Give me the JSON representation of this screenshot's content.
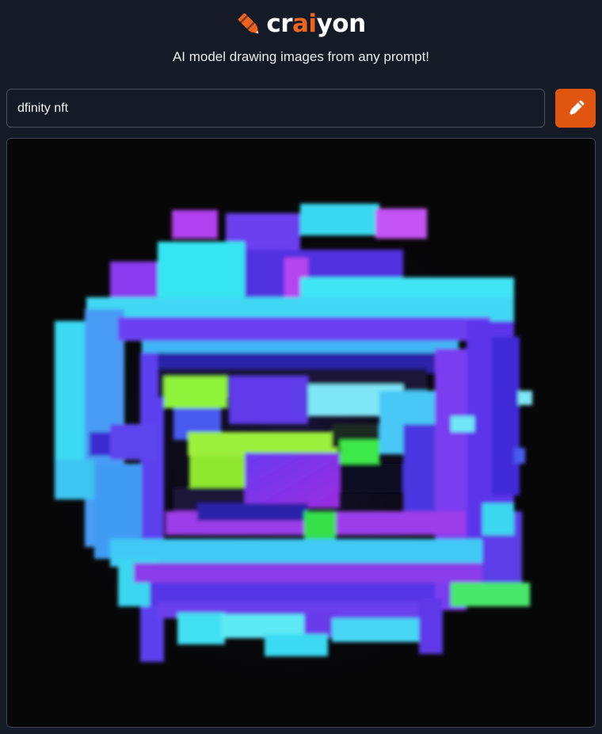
{
  "header": {
    "logo_text_part1": "cr",
    "logo_text_accent": "ai",
    "logo_text_part2": "yon",
    "tagline": "AI model drawing images from any prompt!",
    "logo_icon": "crayon-icon",
    "accent_color": "#f0651e"
  },
  "prompt": {
    "value": "dfinity nft",
    "button_icon": "pencil-icon",
    "button_color": "#e0550f"
  },
  "result": {
    "image_subject": "dfinity nft"
  },
  "colors": {
    "background": "#141a26",
    "border": "#4a5160"
  }
}
